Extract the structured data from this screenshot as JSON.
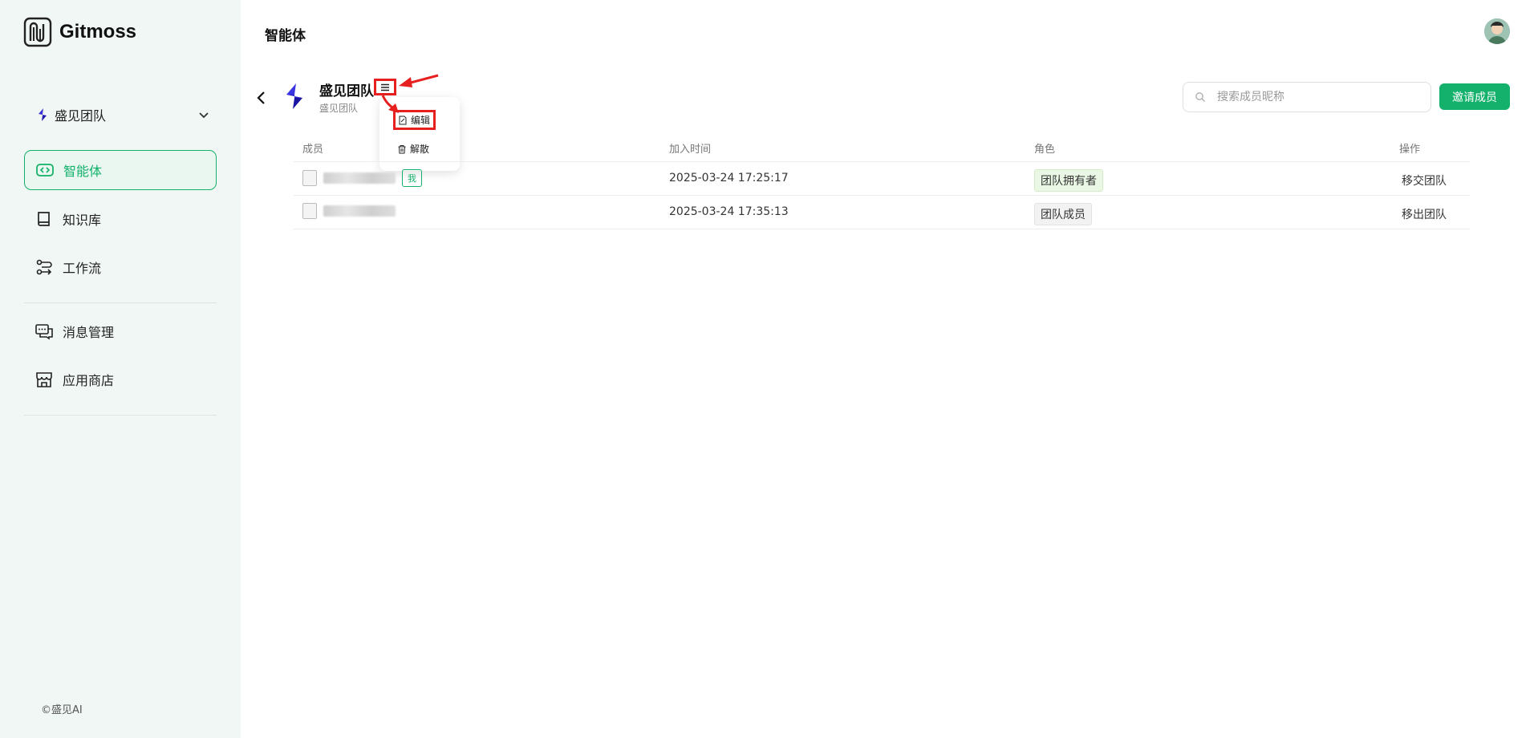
{
  "app": {
    "name": "Gitmoss"
  },
  "sidebar": {
    "team": {
      "name": "盛见团队"
    },
    "items": [
      {
        "label": "智能体",
        "icon": "agent-icon",
        "active": true
      },
      {
        "label": "知识库",
        "icon": "book-icon",
        "active": false
      },
      {
        "label": "工作流",
        "icon": "workflow-icon",
        "active": false
      },
      {
        "label": "消息管理",
        "icon": "message-icon",
        "active": false
      },
      {
        "label": "应用商店",
        "icon": "store-icon",
        "active": false
      }
    ],
    "copyright": "©盛见AI"
  },
  "header": {
    "title": "智能体"
  },
  "team_header": {
    "title": "盛见团队",
    "subtitle": "盛见团队",
    "menu": {
      "edit_label": "编辑",
      "dissolve_label": "解散"
    }
  },
  "search": {
    "placeholder": "搜索成员昵称"
  },
  "invite_label": "邀请成员",
  "table": {
    "columns": [
      "成员",
      "加入时间",
      "角色",
      "操作"
    ],
    "rows": [
      {
        "me_tag": "我",
        "join_time": "2025-03-24 17:25:17",
        "role": "团队拥有者",
        "action": "移交团队"
      },
      {
        "me_tag": "",
        "join_time": "2025-03-24 17:35:13",
        "role": "团队成员",
        "action": "移出团队"
      }
    ]
  },
  "colors": {
    "accent": "#13b16b",
    "annotation": "#e5201f",
    "sidebar_bg": "#f0f7f4"
  }
}
